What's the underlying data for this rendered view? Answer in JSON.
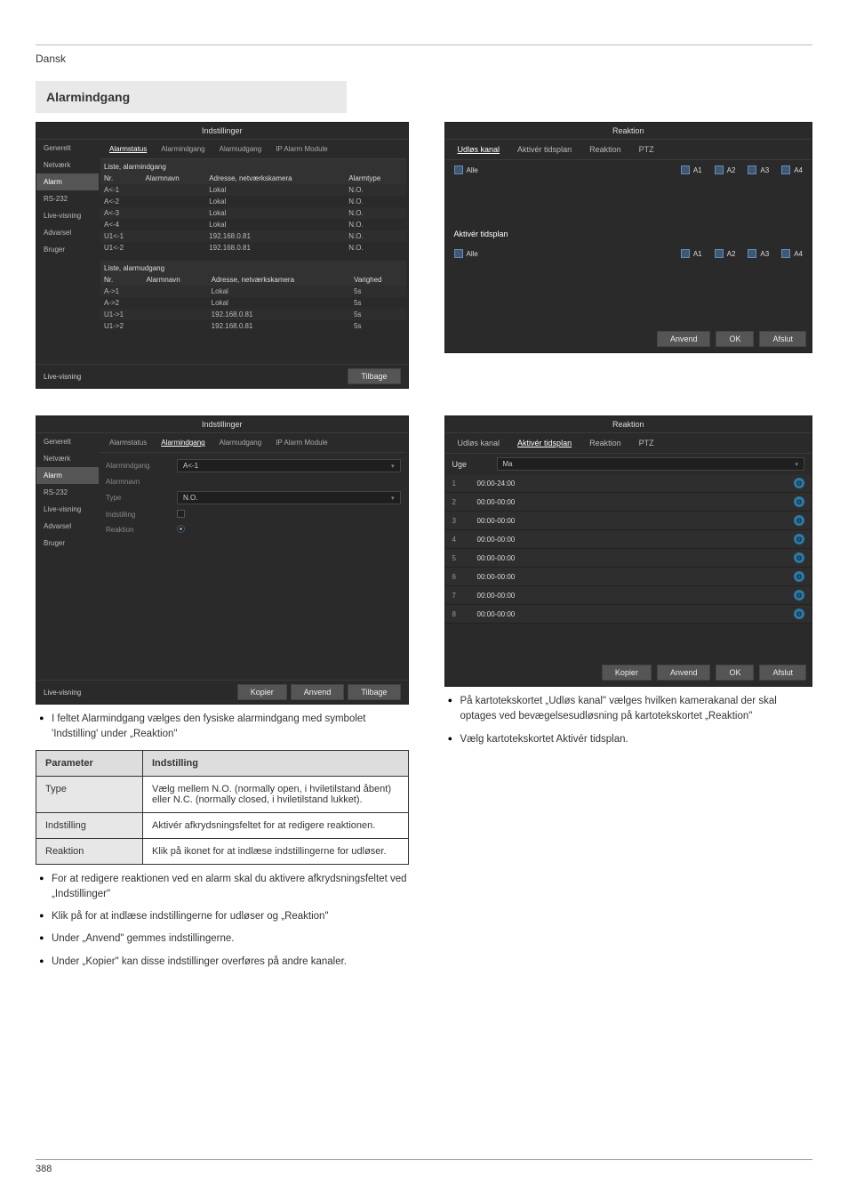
{
  "header": {
    "left": "Dansk"
  },
  "section_title": "Alarmindgang",
  "shot1": {
    "title": "Indstillinger",
    "sidebar": [
      "Generelt",
      "Netværk",
      "Alarm",
      "RS-232",
      "Live-visning",
      "Advarsel",
      "Bruger"
    ],
    "active_side": "Alarm",
    "subtabs": [
      "Alarmstatus",
      "Alarmindgang",
      "Alarmudgang",
      "IP Alarm Module"
    ],
    "active_subtab": "Alarmstatus",
    "list_in_label": "Liste, alarmindgang",
    "list_out_label": "Liste, alarmudgang",
    "cols_in": [
      "Nr.",
      "Alarmnavn",
      "Adresse, netværkskamera",
      "Alarmtype"
    ],
    "rows_in": [
      {
        "nr": "A<-1",
        "name": "",
        "addr": "Lokal",
        "type": "N.O."
      },
      {
        "nr": "A<-2",
        "name": "",
        "addr": "Lokal",
        "type": "N.O."
      },
      {
        "nr": "A<-3",
        "name": "",
        "addr": "Lokal",
        "type": "N.O."
      },
      {
        "nr": "A<-4",
        "name": "",
        "addr": "Lokal",
        "type": "N.O."
      },
      {
        "nr": "U1<-1",
        "name": "",
        "addr": "192.168.0.81",
        "type": "N.O."
      },
      {
        "nr": "U1<-2",
        "name": "",
        "addr": "192.168.0.81",
        "type": "N.O."
      }
    ],
    "cols_out": [
      "Nr.",
      "Alarmnavn",
      "Adresse, netværkskamera",
      "Varighed"
    ],
    "rows_out": [
      {
        "nr": "A->1",
        "name": "",
        "addr": "Lokal",
        "dur": "5s"
      },
      {
        "nr": "A->2",
        "name": "",
        "addr": "Lokal",
        "dur": "5s"
      },
      {
        "nr": "U1->1",
        "name": "",
        "addr": "192.168.0.81",
        "dur": "5s"
      },
      {
        "nr": "U1->2",
        "name": "",
        "addr": "192.168.0.81",
        "dur": "5s"
      }
    ],
    "live_label": "Live-visning",
    "back_btn": "Tilbage"
  },
  "shot2": {
    "title": "Reaktion",
    "tabs": [
      "Udløs kanal",
      "Aktivér tidsplan",
      "Reaktion",
      "PTZ"
    ],
    "active_tab": "Udløs kanal",
    "alle": "Alle",
    "channels": [
      "A1",
      "A2",
      "A3",
      "A4"
    ],
    "schedule_hdr": "Aktivér tidsplan",
    "btn_apply": "Anvend",
    "btn_ok": "OK",
    "btn_exit": "Afslut"
  },
  "shot3": {
    "title": "Indstillinger",
    "sidebar": [
      "Generelt",
      "Netværk",
      "Alarm",
      "RS-232",
      "Live-visning",
      "Advarsel",
      "Bruger"
    ],
    "active_side": "Alarm",
    "subtabs": [
      "Alarmstatus",
      "Alarmindgang",
      "Alarmudgang",
      "IP Alarm Module"
    ],
    "active_subtab": "Alarmindgang",
    "rows": [
      {
        "lbl": "Alarmindgang",
        "val": "A<-1",
        "type": "select"
      },
      {
        "lbl": "Alarmnavn",
        "val": "",
        "type": "text"
      },
      {
        "lbl": "Type",
        "val": "N.O.",
        "type": "select"
      },
      {
        "lbl": "Indstilling",
        "val": "",
        "type": "check"
      },
      {
        "lbl": "Reaktion",
        "val": "",
        "type": "radio"
      }
    ],
    "live_label": "Live-visning",
    "btn_copy": "Kopier",
    "btn_apply": "Anvend",
    "btn_back": "Tilbage"
  },
  "shot4": {
    "title": "Reaktion",
    "tabs": [
      "Udløs kanal",
      "Aktivér tidsplan",
      "Reaktion",
      "PTZ"
    ],
    "active_tab": "Aktivér tidsplan",
    "week_lbl": "Uge",
    "day": "Ma",
    "rows": [
      {
        "n": "1",
        "r": "00:00-24:00"
      },
      {
        "n": "2",
        "r": "00:00-00:00"
      },
      {
        "n": "3",
        "r": "00:00-00:00"
      },
      {
        "n": "4",
        "r": "00:00-00:00"
      },
      {
        "n": "5",
        "r": "00:00-00:00"
      },
      {
        "n": "6",
        "r": "00:00-00:00"
      },
      {
        "n": "7",
        "r": "00:00-00:00"
      },
      {
        "n": "8",
        "r": "00:00-00:00"
      }
    ],
    "btn_copy": "Kopier",
    "btn_apply": "Anvend",
    "btn_ok": "OK",
    "btn_exit": "Afslut"
  },
  "bullets_left": [
    "I feltet Alarmindgang vælges den fysiske alarmindgang med symbolet 'Indstilling' under „Reaktion\""
  ],
  "param_table": {
    "head": [
      "Parameter",
      "Indstilling"
    ],
    "rows": [
      [
        "Type",
        "Vælg mellem N.O. (normally open, i hviletilstand åbent) eller N.C. (normally closed, i hviletilstand lukket)."
      ],
      [
        "Indstilling",
        "Aktivér afkrydsningsfeltet for at redigere reaktionen."
      ],
      [
        "Reaktion",
        "Klik på ikonet for at indlæse indstillingerne for udløser."
      ]
    ]
  },
  "bullets_left2": [
    "For at redigere reaktionen ved en alarm skal du aktivere afkrydsningsfeltet ved „Indstillinger\"",
    "Klik på   for at indlæse indstillingerne for udløser og „Reaktion\"",
    "Under „Anvend\" gemmes indstillingerne.",
    "Under „Kopier\" kan disse indstillinger overføres på andre kanaler."
  ],
  "bullets_right": [
    "På kartotekskortet „Udløs kanal\" vælges hvilken kamerakanal der skal optages ved bevægelsesudløsning på kartotekskortet „Reaktion\"",
    "Vælg kartotekskortet Aktivér tidsplan."
  ],
  "footer": {
    "left": "388",
    "right": ""
  }
}
